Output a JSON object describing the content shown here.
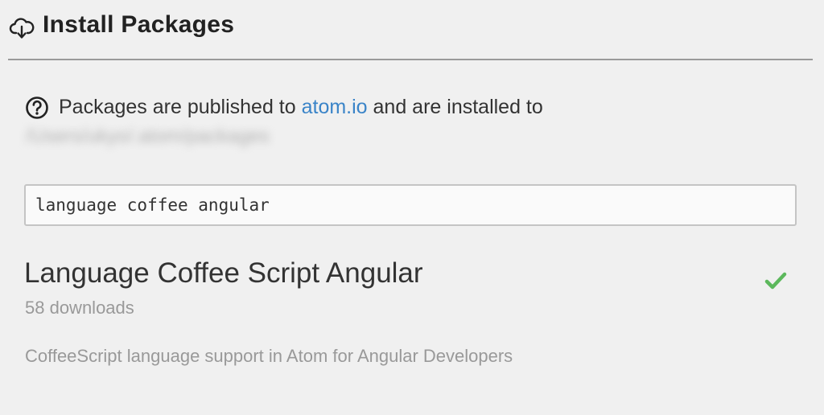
{
  "header": {
    "icon": "cloud-download-icon",
    "title": "Install Packages"
  },
  "info": {
    "icon": "question-circle-icon",
    "text_before": "Packages are published to ",
    "link_text": "atom.io",
    "text_after": " and are installed to",
    "install_path": "/Users/ukyo/.atom/packages"
  },
  "search": {
    "value": "language coffee angular",
    "placeholder": ""
  },
  "results": [
    {
      "name": "Language Coffee Script Angular",
      "downloads": "58 downloads",
      "description": "CoffeeScript language support in Atom for Angular Developers",
      "status_icon": "check-icon",
      "status_color": "#5cb85c"
    }
  ],
  "colors": {
    "link": "#3a84c8",
    "installed_check": "#5cb85c",
    "divider": "#9a9a9a"
  }
}
